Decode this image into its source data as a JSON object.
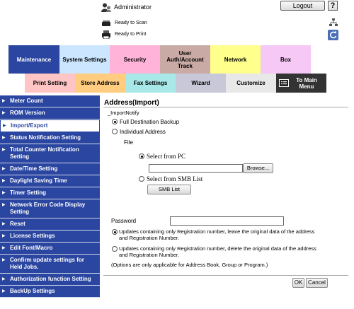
{
  "header": {
    "user_label": "Administrator",
    "logout_label": "Logout",
    "help_label": "?",
    "status_scan": "Ready to Scan",
    "status_print": "Ready to Print"
  },
  "tabs_row1": [
    {
      "label": "Maintenance",
      "color": "#2b46a0",
      "text_color": "#ffffff"
    },
    {
      "label": "System Settings",
      "color": "#cce6ff",
      "text_color": "#000000"
    },
    {
      "label": "Security",
      "color": "#ffb3d9",
      "text_color": "#000000"
    },
    {
      "label": "User Auth/Account Track",
      "color": "#c9aaa4",
      "text_color": "#000000"
    },
    {
      "label": "Network",
      "color": "#ffff8c",
      "text_color": "#000000"
    },
    {
      "label": "Box",
      "color": "#f5c8f5",
      "text_color": "#000000"
    }
  ],
  "tabs_row2": [
    {
      "label": "Print Setting",
      "color": "#ffc4c4",
      "text_color": "#000000"
    },
    {
      "label": "Store Address",
      "color": "#ffcc80",
      "text_color": "#000000"
    },
    {
      "label": "Fax Settings",
      "color": "#a8e8e8",
      "text_color": "#000000"
    },
    {
      "label": "Wizard",
      "color": "#c8c8d8",
      "text_color": "#000000"
    },
    {
      "label": "Customize",
      "color": "#e8e8e8",
      "text_color": "#000000"
    },
    {
      "label": "To Main Menu",
      "color": "#333333",
      "text_color": "#ffffff"
    }
  ],
  "sidebar": {
    "items": [
      {
        "label": "Meter Count"
      },
      {
        "label": "ROM Version"
      },
      {
        "label": "Import/Export",
        "active": true
      },
      {
        "label": "Status Notification Setting"
      },
      {
        "label": "Total Counter Notification Setting"
      },
      {
        "label": "Date/Time Setting"
      },
      {
        "label": "Daylight Saving Time"
      },
      {
        "label": "Timer Setting"
      },
      {
        "label": "Network Error Code Display Setting"
      },
      {
        "label": "Reset"
      },
      {
        "label": "License Settings"
      },
      {
        "label": "Edit Font/Macro"
      },
      {
        "label": "Confirm update settings for Held Jobs."
      },
      {
        "label": "Authorization function Setting"
      },
      {
        "label": "BackUp Settings"
      }
    ]
  },
  "main": {
    "title": "Address(Import)",
    "import_notify": "_ImportNotify",
    "full_backup_label": "Full Destination Backup",
    "individual_label": "Individual Address",
    "file_label": "File",
    "select_pc_label": "Select from PC",
    "browse_label": "Browse...",
    "select_smb_label": "Select from SMB List",
    "smb_list_label": "SMB List",
    "password_label": "Password",
    "password_value": "",
    "option1": "Updates containing only Registration number, leave the original data of the address and Registration Number.",
    "option2": "Updates containing only Registration number, delete the original data of the address and Registration Number.",
    "note": "(Options are only applicable for Address Book, Group or Program.)",
    "ok_label": "OK",
    "cancel_label": "Cancel",
    "selected_import": "Full Destination Backup",
    "selected_file_source": "Select from PC",
    "selected_option": "option1"
  }
}
